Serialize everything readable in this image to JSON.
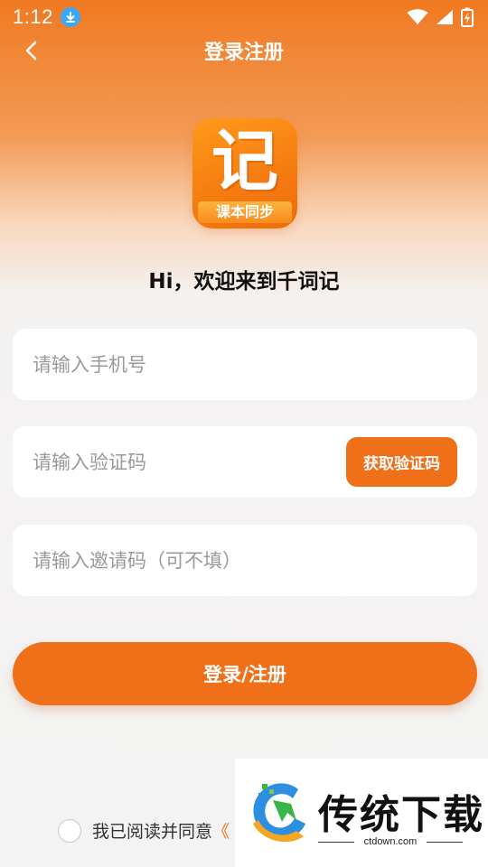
{
  "status_bar": {
    "time": "1:12"
  },
  "nav": {
    "title": "登录注册"
  },
  "logo": {
    "char": "记",
    "ribbon": "课本同步"
  },
  "welcome": "Hi，欢迎来到千词记",
  "form": {
    "phone_placeholder": "请输入手机号",
    "code_placeholder": "请输入验证码",
    "code_button": "获取验证码",
    "invite_placeholder": "请输入邀请码（可不填）"
  },
  "login_button": "登录/注册",
  "agreement": {
    "text": "我已阅读并同意",
    "link": "《"
  },
  "watermark": {
    "name": "传统下载",
    "domain": "ctdown.com"
  },
  "colors": {
    "accent": "#f07019"
  }
}
